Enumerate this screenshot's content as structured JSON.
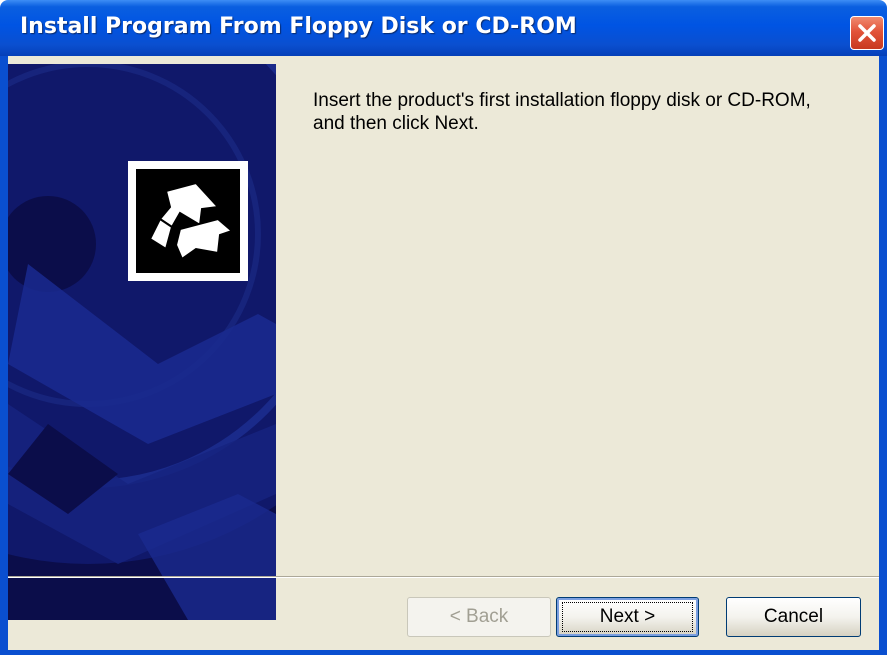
{
  "window": {
    "title": "Install Program From Floppy Disk or CD-ROM"
  },
  "body": {
    "message": "Insert the product's first installation floppy disk or CD-ROM,\nand then click Next."
  },
  "buttons": {
    "back": "< Back",
    "next": "Next >",
    "cancel": "Cancel"
  },
  "icons": {
    "close": "close-icon",
    "banner": "cd-disc-graphic",
    "logo": "install-arrow-icon"
  },
  "colors": {
    "titlebar": "#0054e3",
    "banner": "#0b0d4a",
    "dialog": "#ece9d8",
    "close": "#e2543a"
  }
}
